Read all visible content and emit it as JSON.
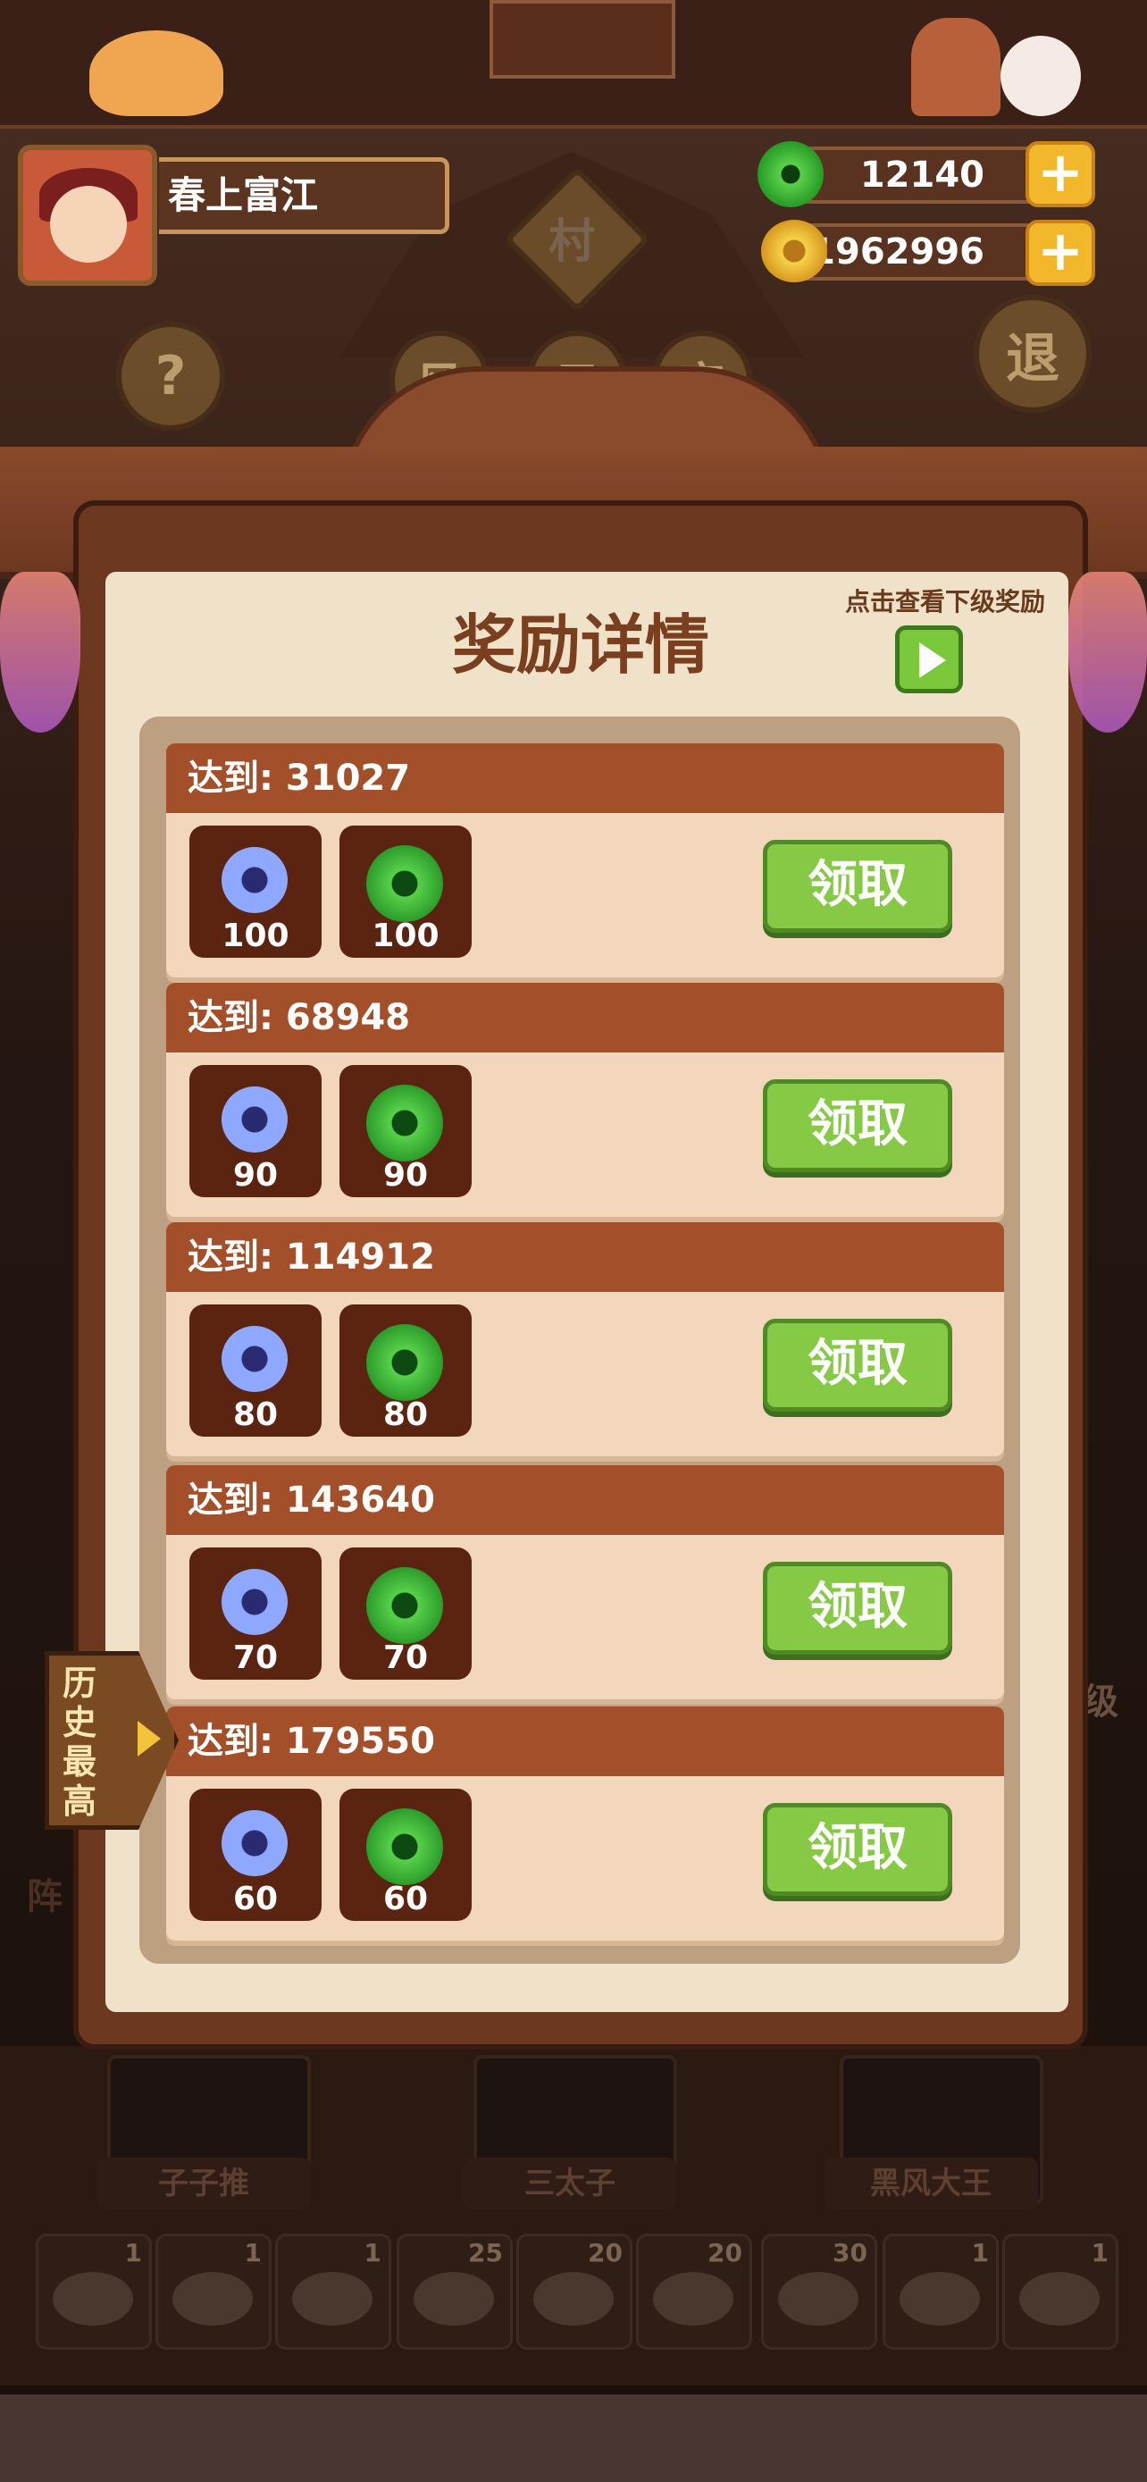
{
  "player": {
    "name": "春上富江"
  },
  "currencies": [
    {
      "name": "jade",
      "value": "12140",
      "color": "#3bbd3b"
    },
    {
      "name": "coin",
      "value": "1962996",
      "color": "#f2c030"
    }
  ],
  "background": {
    "village_sign": "村",
    "help_sign": "?",
    "exit_sign": "退",
    "shop_signs": [
      "风",
      "云",
      "宫"
    ],
    "side_label_left": "阵",
    "side_label_right": "级"
  },
  "modal": {
    "title": "奖励详情",
    "hint": "点击查看下级奖励",
    "rows": [
      {
        "threshold_label": "达到: 31027",
        "items": [
          {
            "icon": "blue-ring-icon",
            "qty": "100"
          },
          {
            "icon": "green-jade-icon",
            "qty": "100"
          }
        ],
        "button": "领取"
      },
      {
        "threshold_label": "达到: 68948",
        "items": [
          {
            "icon": "blue-ring-icon",
            "qty": "90"
          },
          {
            "icon": "green-jade-icon",
            "qty": "90"
          }
        ],
        "button": "领取"
      },
      {
        "threshold_label": "达到: 114912",
        "items": [
          {
            "icon": "blue-ring-icon",
            "qty": "80"
          },
          {
            "icon": "green-jade-icon",
            "qty": "80"
          }
        ],
        "button": "领取"
      },
      {
        "threshold_label": "达到: 143640",
        "items": [
          {
            "icon": "blue-ring-icon",
            "qty": "70"
          },
          {
            "icon": "green-jade-icon",
            "qty": "70"
          }
        ],
        "button": "领取"
      },
      {
        "threshold_label": "达到: 179550",
        "items": [
          {
            "icon": "blue-ring-icon",
            "qty": "60"
          },
          {
            "icon": "green-jade-icon",
            "qty": "60"
          }
        ],
        "button": "领取"
      }
    ]
  },
  "history_tab": {
    "label": "历史最高"
  },
  "heroes": [
    {
      "name": "子子推"
    },
    {
      "name": "三太子"
    },
    {
      "name": "黑风大王"
    }
  ],
  "dishes": [
    {
      "count": "1"
    },
    {
      "count": "1"
    },
    {
      "count": "1"
    },
    {
      "count": "25"
    },
    {
      "count": "20"
    },
    {
      "count": "20"
    },
    {
      "count": "30"
    },
    {
      "count": "1"
    },
    {
      "count": "1"
    }
  ]
}
